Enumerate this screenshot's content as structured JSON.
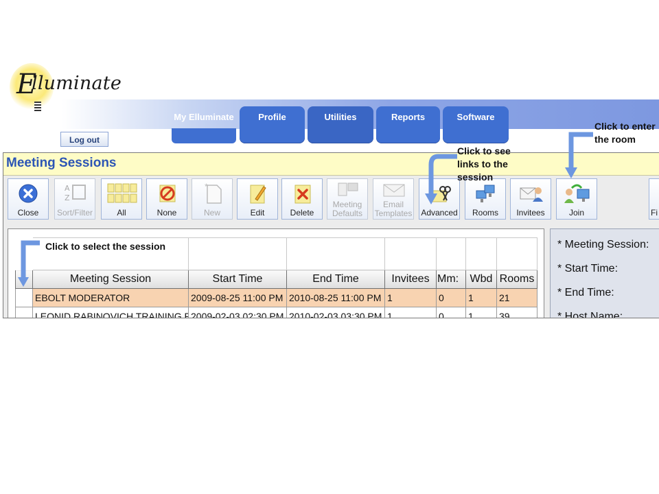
{
  "logo": {
    "text": "lluminate",
    "initial": "E"
  },
  "nav": {
    "tabs": [
      {
        "label": "My Elluminate"
      },
      {
        "label": "Profile"
      },
      {
        "label": "Utilities"
      },
      {
        "label": "Reports"
      },
      {
        "label": "Software"
      }
    ],
    "logout_label": "Log out"
  },
  "app": {
    "title": "Meeting Sessions",
    "toolbar": [
      {
        "label": "Close",
        "icon": "close-icon",
        "enabled": true
      },
      {
        "label": "Sort/Filter",
        "icon": "sort-filter-icon",
        "enabled": false
      },
      {
        "label": "All",
        "icon": "select-all-icon",
        "enabled": true
      },
      {
        "label": "None",
        "icon": "select-none-icon",
        "enabled": true
      },
      {
        "label": "New",
        "icon": "new-icon",
        "enabled": false
      },
      {
        "label": "Edit",
        "icon": "edit-icon",
        "enabled": true
      },
      {
        "label": "Delete",
        "icon": "delete-icon",
        "enabled": true
      },
      {
        "label": "Meeting Defaults",
        "icon": "meeting-defaults-icon",
        "enabled": false
      },
      {
        "label": "Email Templates",
        "icon": "email-templates-icon",
        "enabled": false
      },
      {
        "label": "Advanced",
        "icon": "advanced-icon",
        "enabled": true
      },
      {
        "label": "Rooms",
        "icon": "rooms-icon",
        "enabled": true
      },
      {
        "label": "Invitees",
        "icon": "invitees-icon",
        "enabled": true
      },
      {
        "label": "Join",
        "icon": "join-icon",
        "enabled": true
      },
      {
        "label": "Fi",
        "icon": "find-icon",
        "enabled": true
      }
    ],
    "table": {
      "columns": [
        "Meeting Session",
        "Start Time",
        "End Time",
        "Invitees",
        "Mm:",
        "Wbd",
        "Rooms"
      ],
      "rows": [
        [
          "EBOLT MODERATOR",
          "2009-08-25 11:00 PM",
          "2010-08-25 11:00 PM",
          "1",
          "0",
          "1",
          "21"
        ],
        [
          "LEONID RABINOVICH TRAINING ROOM",
          "2009-02-03 02:30 PM",
          "2010-02-03 03:30 PM",
          "1",
          "0",
          "1",
          "39"
        ]
      ]
    },
    "details": {
      "labels": [
        "* Meeting Session:",
        "* Start Time:",
        "* End Time:",
        "* Host Name:"
      ]
    }
  },
  "annotations": {
    "select": "Click to select the session",
    "advanced": "Click to see links to the session",
    "join": "Click to enter the room"
  },
  "colors": {
    "title": "#2c55b5",
    "tab": "#3f6fd1",
    "selected_row": "#f8d3b1",
    "title_bar": "#fefcc6"
  }
}
